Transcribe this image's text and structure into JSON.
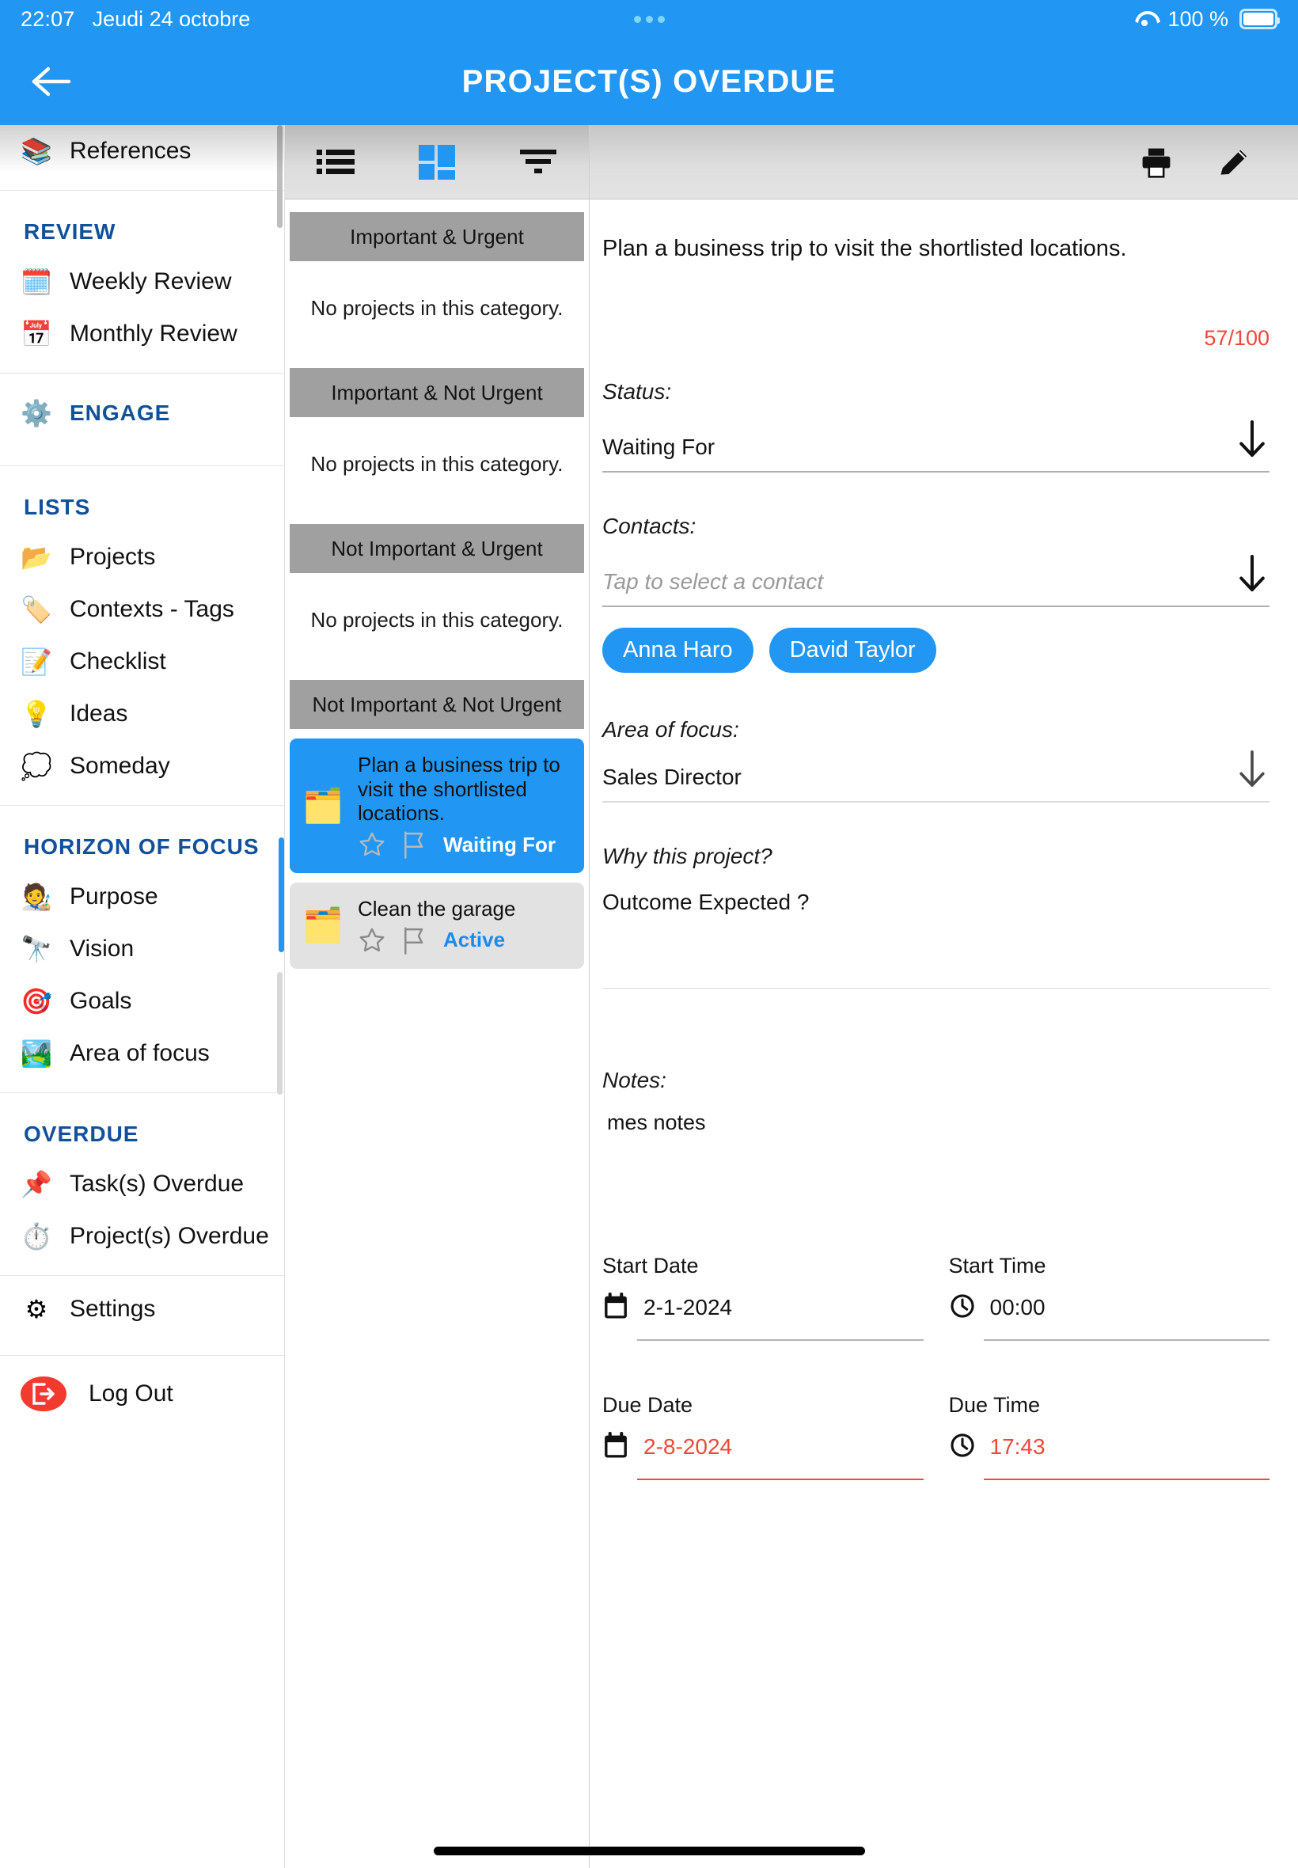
{
  "status_bar": {
    "time": "22:07",
    "date": "Jeudi 24 octobre",
    "battery_percent": "100 %",
    "wifi_icon": "wifi-icon",
    "battery_icon": "battery-full-icon",
    "recording_dots_icon": "three-dots-icon"
  },
  "app_bar": {
    "back_icon": "arrow-left-icon",
    "title": "PROJECT(S) OVERDUE"
  },
  "sidebar": {
    "top_item": {
      "label": "References",
      "icon": "books-icon"
    },
    "sections": [
      {
        "heading": "REVIEW",
        "items": [
          {
            "label": "Weekly Review",
            "icon": "calendar-week-icon"
          },
          {
            "label": "Monthly Review",
            "icon": "calendar-month-icon"
          }
        ]
      },
      {
        "heading": "ENGAGE",
        "heading_icon": "gears-icon",
        "heading_is_row": true,
        "items": []
      },
      {
        "heading": "LISTS",
        "items": [
          {
            "label": "Projects",
            "icon": "folder-open-icon"
          },
          {
            "label": "Contexts - Tags",
            "icon": "tags-icon"
          },
          {
            "label": "Checklist",
            "icon": "checklist-icon"
          },
          {
            "label": "Ideas",
            "icon": "lightbulb-icon"
          },
          {
            "label": "Someday",
            "icon": "thought-bubble-icon"
          }
        ]
      },
      {
        "heading": "HORIZON OF FOCUS",
        "items": [
          {
            "label": "Purpose",
            "icon": "person-target-icon"
          },
          {
            "label": "Vision",
            "icon": "binoculars-icon"
          },
          {
            "label": "Goals",
            "icon": "target-dart-icon"
          },
          {
            "label": "Area of focus",
            "icon": "landscape-icon"
          }
        ]
      },
      {
        "heading": "OVERDUE",
        "items": [
          {
            "label": "Task(s) Overdue",
            "icon": "task-clock-icon"
          },
          {
            "label": "Project(s) Overdue",
            "icon": "stopwatch-warning-icon"
          }
        ]
      }
    ],
    "settings": {
      "label": "Settings",
      "icon": "gear-icon"
    },
    "logout": {
      "label": "Log Out",
      "icon": "logout-icon"
    }
  },
  "middle": {
    "toolbar": [
      {
        "name": "list-view-button",
        "icon": "list-icon",
        "active": false
      },
      {
        "name": "matrix-view-button",
        "icon": "grid-dashboard-icon",
        "active": true
      },
      {
        "name": "filter-button",
        "icon": "filter-icon",
        "active": false
      }
    ],
    "empty_text": "No projects in this category.",
    "categories": [
      {
        "title": "Important & Urgent",
        "projects": []
      },
      {
        "title": "Important & Not Urgent",
        "projects": []
      },
      {
        "title": "Not Important & Urgent",
        "projects": []
      },
      {
        "title": "Not Important & Not Urgent",
        "projects": [
          {
            "title": "Plan a business trip to visit the shortlisted locations.",
            "status": "Waiting For",
            "selected": true,
            "icon": "folder-search-icon",
            "star_icon": "star-outline-icon",
            "flag_icon": "flag-outline-icon"
          },
          {
            "title": "Clean the garage",
            "status": "Active",
            "selected": false,
            "icon": "folder-search-icon",
            "star_icon": "star-outline-icon",
            "flag_icon": "flag-outline-icon"
          }
        ]
      }
    ]
  },
  "detail": {
    "toolbar": {
      "print_icon": "printer-icon",
      "edit_icon": "pencil-icon"
    },
    "title": "Plan a business trip to visit the shortlisted locations.",
    "char_counter": "57/100",
    "status": {
      "label": "Status:",
      "value": "Waiting For",
      "arrow_icon": "arrow-down-icon"
    },
    "contacts": {
      "label": "Contacts:",
      "placeholder": "Tap to select a contact",
      "arrow_icon": "arrow-down-icon",
      "chips": [
        "Anna Haro",
        "David Taylor"
      ]
    },
    "area_of_focus": {
      "label": "Area of focus:",
      "value": "Sales Director",
      "arrow_icon": "arrow-down-icon"
    },
    "why": {
      "label": "Why this project?",
      "value": "Outcome Expected ?"
    },
    "notes": {
      "label": "Notes:",
      "value": "mes notes"
    },
    "dates": {
      "start_date": {
        "label": "Start Date",
        "value": "2-1-2024",
        "icon": "calendar-icon",
        "overdue": false
      },
      "start_time": {
        "label": "Start Time",
        "value": "00:00",
        "icon": "clock-icon",
        "overdue": false
      },
      "due_date": {
        "label": "Due Date",
        "value": "2-8-2024",
        "icon": "calendar-icon",
        "overdue": true
      },
      "due_time": {
        "label": "Due Time",
        "value": "17:43",
        "icon": "clock-icon",
        "overdue": true
      }
    }
  },
  "colors": {
    "accent": "#2196f3",
    "overdue": "#f0483a",
    "section_heading": "#11519c",
    "category_header": "#a0a0a0"
  }
}
